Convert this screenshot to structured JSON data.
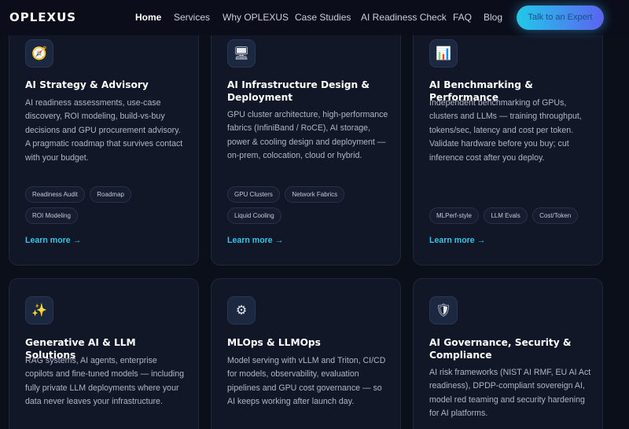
{
  "brand": "OPLEXUS",
  "nav": {
    "links": [
      "Home",
      "Services",
      "Why OPLEXUS",
      "Case Studies",
      "AI Readiness Check",
      "FAQ",
      "Blog"
    ],
    "cta": "Talk to an Expert"
  },
  "cards": [
    {
      "icon": "compass-icon",
      "glyph": "🧭",
      "title": "AI Strategy & Advisory",
      "desc": "AI readiness assessments, use-case discovery, ROI modeling, build-vs-buy decisions and GPU procurement advisory. A pragmatic roadmap that survives contact with your budget.",
      "tags": [
        "Readiness Audit",
        "Roadmap",
        "ROI Modeling"
      ],
      "more": "Learn more →"
    },
    {
      "icon": "server-icon",
      "glyph": "🖥",
      "title": "AI Infrastructure Design & Deployment",
      "desc": "GPU cluster architecture, high-performance fabrics (InfiniBand / RoCE), AI storage, power & cooling design and deployment — on-prem, colocation, cloud or hybrid.",
      "tags": [
        "GPU Clusters",
        "Network Fabrics",
        "Liquid Cooling"
      ],
      "more": "Learn more →"
    },
    {
      "icon": "chart-icon",
      "glyph": "📊",
      "title": "AI Benchmarking & Performance",
      "desc": "Independent benchmarking of GPUs, clusters and LLMs — training throughput, tokens/sec, latency and cost per token. Validate hardware before you buy; cut inference cost after you deploy.",
      "tags": [
        "MLPerf-style",
        "LLM Evals",
        "Cost/Token"
      ],
      "more": "Learn more →"
    },
    {
      "icon": "sparkles-icon",
      "glyph": "✨",
      "title": "Generative AI & LLM Solutions",
      "desc": "RAG systems, AI agents, enterprise copilots and fine-tuned models — including fully private LLM deployments where your data never leaves your infrastructure."
    },
    {
      "icon": "gear-icon",
      "glyph": "⚙",
      "title": "MLOps & LLMOps",
      "desc": "Model serving with vLLM and Triton, CI/CD for models, observability, evaluation pipelines and GPU cost governance — so AI keeps working after launch day."
    },
    {
      "icon": "shield-icon",
      "glyph": "🛡",
      "title": "AI Governance, Security & Compliance",
      "desc": "AI risk frameworks (NIST AI RMF, EU AI Act readiness), DPDP-compliant sovereign AI, model red teaming and security hardening for AI platforms."
    }
  ]
}
